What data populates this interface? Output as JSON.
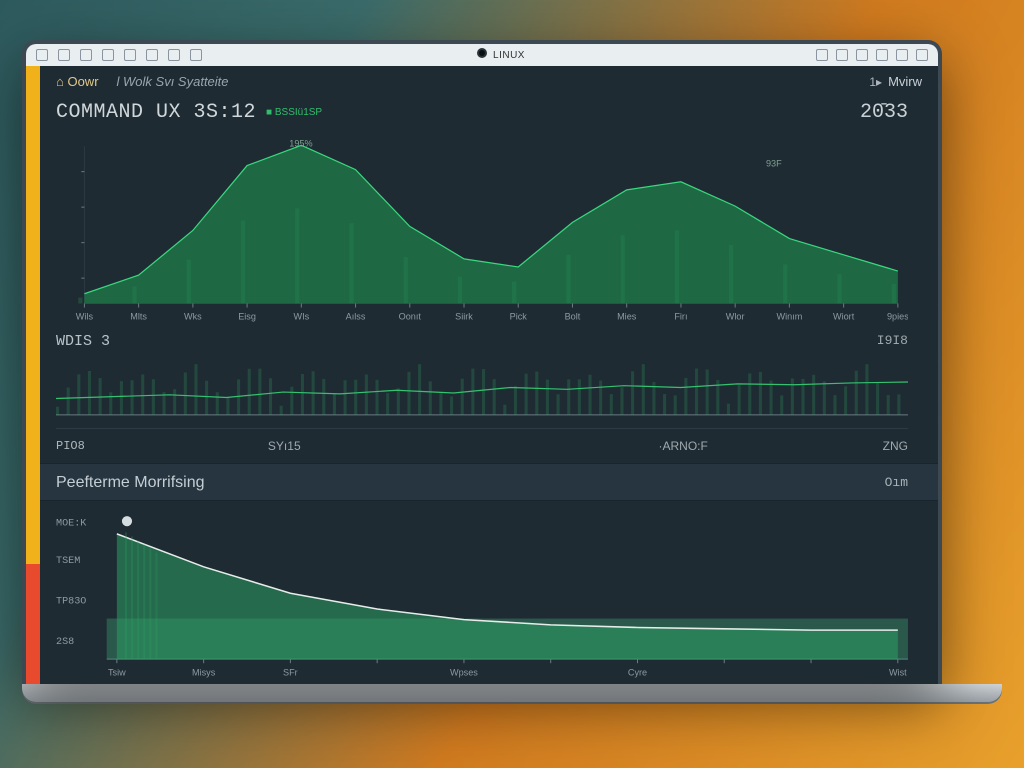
{
  "window": {
    "title": "LINUX",
    "icons_left": [
      "menu-icon",
      "doc-icon",
      "code-icon",
      "arrow-icon",
      "gear-icon",
      "list-icon",
      "grid-icon",
      "file-icon"
    ],
    "icons_right": [
      "help-icon",
      "copy-icon",
      "sync-icon",
      "more-icon",
      "window-icon",
      "close-icon"
    ]
  },
  "topbar": {
    "home": "⌂ Oowr",
    "breadcrumb": "l Wolk Svı Syatteite",
    "right_num": "1▸",
    "right_label": "Mvirw"
  },
  "panel1": {
    "title": "COMMAND UX 3S:12",
    "status": "■ BSSIü1SP",
    "year": "20̄33",
    "peak_label": "195%",
    "value_label": "93F",
    "x_ticks": [
      "Wils",
      "Mlts",
      "Wks",
      "Eisg",
      "WIs",
      "Aılss",
      "Oonıt",
      "Siirk",
      "Pick",
      "Bolt",
      "Mies",
      "Firı",
      "Wlor",
      "Winım",
      "Wiort",
      "9pies"
    ]
  },
  "panel2": {
    "title": "WDIS 3",
    "right_value": "I9I8",
    "divider_left": "PIO8",
    "divider_mid": "SYı15",
    "divider_mid2": "·ARNO:F",
    "divider_right": "ZNG",
    "x_ticks": [
      "",
      "",
      "",
      "",
      "",
      "",
      "",
      "",
      "",
      "",
      "",
      "",
      "",
      "",
      "",
      ""
    ]
  },
  "bottom": {
    "title": "Peefterme Morrifsing",
    "right": "Oım",
    "left_label": "MOE:K",
    "y_ticks": [
      "TSEM",
      "TP83O",
      "2S8"
    ],
    "x_ticks": [
      "Tsiw",
      "Misys",
      "SFr",
      "",
      "Wpses",
      "",
      "Cyre",
      "",
      "",
      "Wist"
    ]
  },
  "chart_data": [
    {
      "type": "area",
      "title": "COMMAND UX 3S:12",
      "ylabel": "",
      "xlabel": "",
      "ylim": [
        0,
        200
      ],
      "peak_label": "195%",
      "categories": [
        "Wils",
        "Mlts",
        "Wks",
        "Eisg",
        "WIs",
        "Aılss",
        "Oonıt",
        "Siirk",
        "Pick",
        "Bolt",
        "Mies",
        "Firı",
        "Wlor",
        "Winım",
        "Wiort",
        "9pies"
      ],
      "values": [
        12,
        35,
        90,
        170,
        195,
        165,
        95,
        55,
        45,
        100,
        140,
        150,
        120,
        80,
        60,
        40
      ]
    },
    {
      "type": "line",
      "title": "WDIS 3",
      "ylim": [
        0,
        60
      ],
      "categories": [
        "",
        "",
        "",
        "",
        "",
        "",
        "",
        "",
        "",
        "",
        "",
        "",
        "",
        "",
        "",
        ""
      ],
      "values": [
        18,
        20,
        22,
        19,
        25,
        23,
        27,
        24,
        30,
        28,
        32,
        30,
        34,
        33,
        35,
        36
      ]
    },
    {
      "type": "area",
      "title": "Peefterme Morrifsing",
      "ylim": [
        0,
        100
      ],
      "categories": [
        "Tsiw",
        "Misys",
        "SFr",
        "",
        "Wpses",
        "",
        "Cyre",
        "",
        "",
        "Wist"
      ],
      "values": [
        95,
        70,
        50,
        38,
        30,
        26,
        24,
        23,
        22,
        22
      ]
    }
  ]
}
